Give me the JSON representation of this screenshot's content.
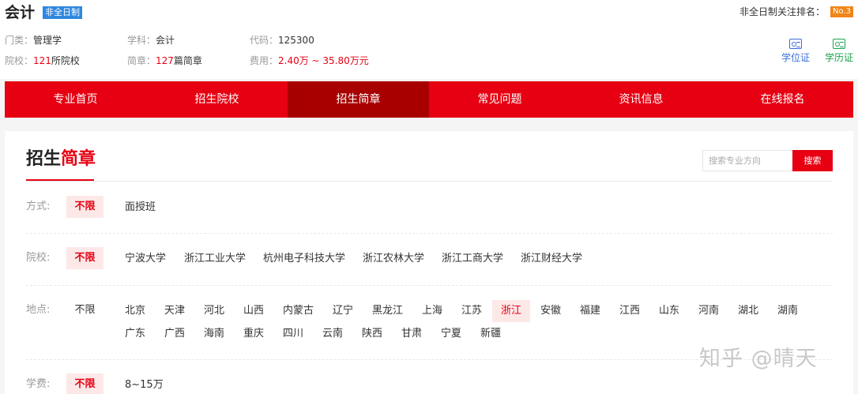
{
  "header": {
    "title": "会计",
    "study_type": "非全日制",
    "rank_label": "非全日制关注排名：",
    "rank_value": "No.3",
    "info": {
      "category_label": "门类：",
      "category_value": "管理学",
      "subject_label": "学科：",
      "subject_value": "会计",
      "code_label": "代码：",
      "code_value": "125300",
      "schools_label": "院校：",
      "schools_count": "121",
      "schools_suffix": "所院校",
      "brochures_label": "简章：",
      "brochures_count": "127",
      "brochures_suffix": "篇简章",
      "fee_label": "费用：",
      "fee_value": "2.40万 ~ 35.80万元"
    },
    "certs": [
      {
        "label": "学位证",
        "icon": "degree-certificate-icon",
        "color": "#3b6fd8"
      },
      {
        "label": "学历证",
        "icon": "diploma-certificate-icon",
        "color": "#1aa34a"
      }
    ]
  },
  "nav": {
    "items": [
      {
        "label": "专业首页"
      },
      {
        "label": "招生院校"
      },
      {
        "label": "招生简章",
        "active": true
      },
      {
        "label": "常见问题"
      },
      {
        "label": "资讯信息"
      },
      {
        "label": "在线报名"
      }
    ],
    "accent": "#e60012",
    "active_color": "#a80000"
  },
  "panel": {
    "title_part1": "招生",
    "title_part2": "简章",
    "search": {
      "placeholder": "搜索专业方向",
      "button": "搜索"
    },
    "filters": {
      "mode": {
        "label": "方式:",
        "any": "不限",
        "options": [
          "面授班"
        ]
      },
      "school": {
        "label": "院校:",
        "any": "不限",
        "options": [
          "宁波大学",
          "浙江工业大学",
          "杭州电子科技大学",
          "浙江农林大学",
          "浙江工商大学",
          "浙江财经大学"
        ]
      },
      "location": {
        "label": "地点:",
        "any": "不限",
        "selected": "浙江",
        "row1": [
          "北京",
          "天津",
          "河北",
          "山西",
          "内蒙古",
          "辽宁",
          "黑龙江",
          "上海",
          "江苏",
          "浙江",
          "安徽",
          "福建",
          "江西",
          "山东",
          "河南",
          "湖北",
          "湖南"
        ],
        "row2": [
          "广东",
          "广西",
          "海南",
          "重庆",
          "四川",
          "云南",
          "陕西",
          "甘肃",
          "宁夏",
          "新疆"
        ]
      },
      "fee": {
        "label": "学费:",
        "any": "不限",
        "options": [
          "8~15万"
        ]
      }
    }
  },
  "watermark": "知乎 @晴天"
}
